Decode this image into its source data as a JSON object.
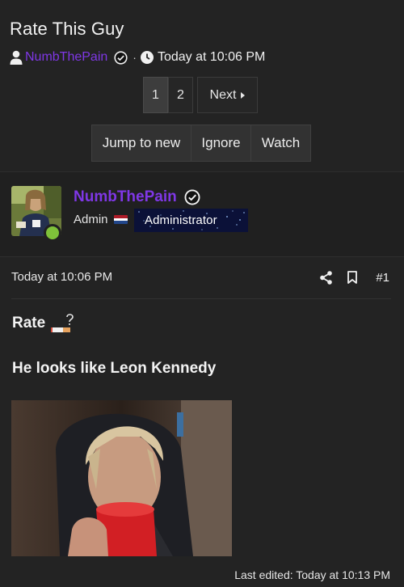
{
  "thread": {
    "title": "Rate This Guy",
    "author": "NumbThePain",
    "separator": "·",
    "date": "Today at 10:06 PM"
  },
  "pagination": {
    "pages": [
      "1",
      "2"
    ],
    "current": "1",
    "next_label": "Next"
  },
  "actions": {
    "jump_label": "Jump to new",
    "ignore_label": "Ignore",
    "watch_label": "Watch"
  },
  "poster": {
    "name": "NumbThePain",
    "title": "Admin",
    "banner": "Administrator",
    "online": true,
    "name_color": "#7f37e6"
  },
  "post": {
    "date": "Today at 10:06 PM",
    "number": "#1",
    "line1": "Rate",
    "line2": "He looks like Leon Kennedy",
    "last_edited": "Last edited: Today at 10:13 PM",
    "emoji_icon": "cigarette-question-icon",
    "image_icon": "photo-blond-man-hoodie-red-cup"
  },
  "icons": {
    "person": "person-icon",
    "verified": "verified-icon",
    "clock": "clock-icon",
    "share": "share-icon",
    "bookmark": "bookmark-icon",
    "caret": "caret-right-icon",
    "flag": "netherlands-flag-icon"
  },
  "colors": {
    "background": "#232323",
    "accent": "#7f37e6",
    "online": "#7ec13a"
  }
}
